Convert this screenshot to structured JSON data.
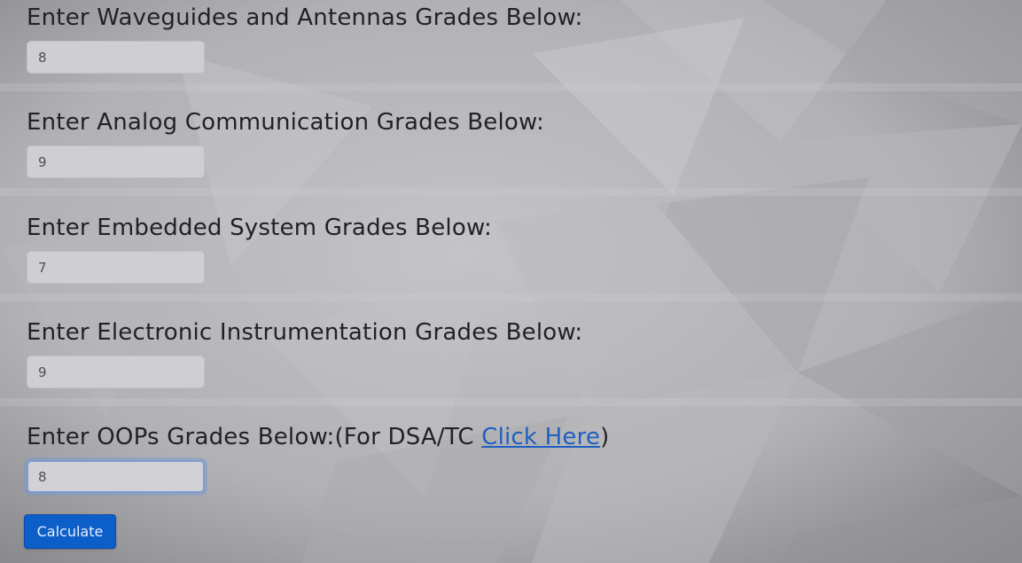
{
  "fields": [
    {
      "label": "Enter Waveguides and Antennas Grades Below:",
      "value": "8"
    },
    {
      "label": "Enter Analog Communication Grades Below:",
      "value": "9"
    },
    {
      "label": "Enter Embedded System Grades Below:",
      "value": "7"
    },
    {
      "label": "Enter Electronic Instrumentation Grades Below:",
      "value": "9"
    },
    {
      "label_prefix": "Enter OOPs Grades Below:(For DSA/TC ",
      "link_text": "Click Here",
      "label_suffix": ")",
      "value": "8"
    }
  ],
  "calculate_button": "Calculate",
  "colors": {
    "button": "#0c5fc8",
    "link": "#1f5fbf",
    "focus_ring": "#7e9cd0"
  }
}
